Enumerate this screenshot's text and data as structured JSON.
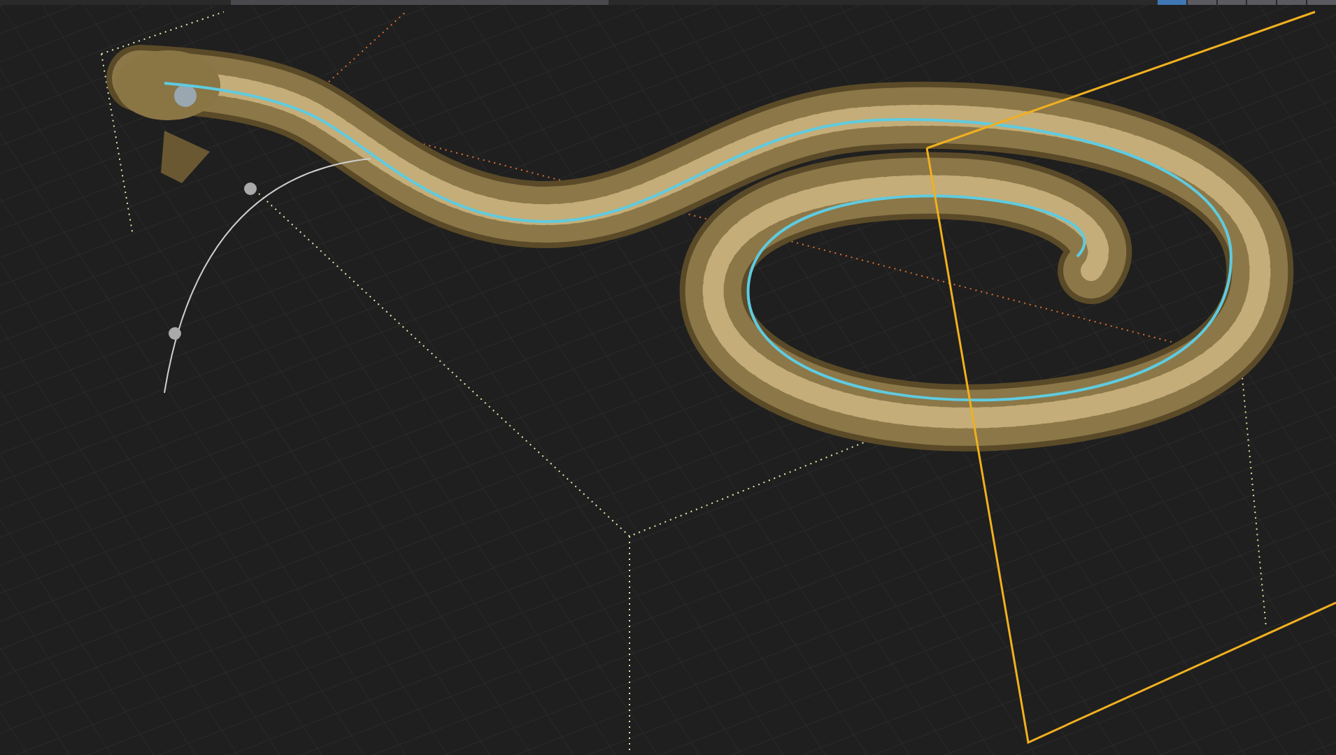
{
  "top_bar": {
    "tabs": [
      {
        "selected": true
      },
      {
        "selected": false
      },
      {
        "selected": false
      },
      {
        "selected": false
      },
      {
        "selected": false
      },
      {
        "selected": false
      }
    ]
  }
}
